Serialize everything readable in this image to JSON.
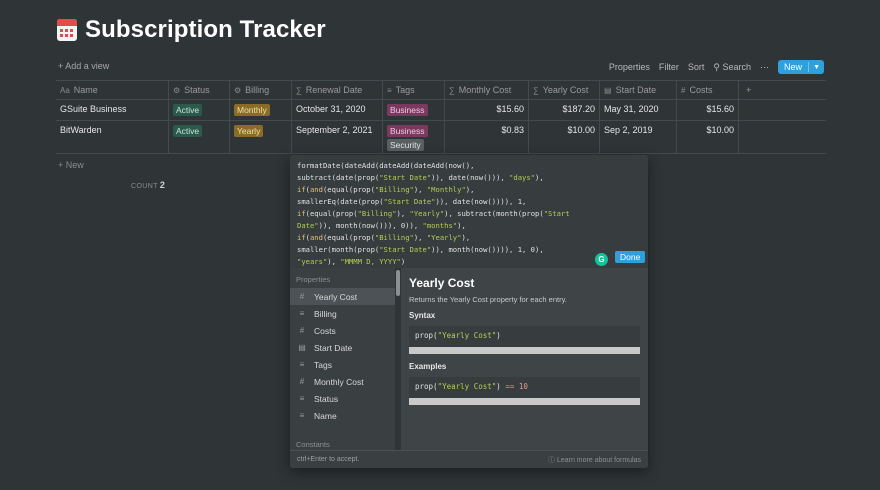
{
  "page": {
    "title": "Subscription Tracker",
    "icon": "calendar-icon"
  },
  "toolbar": {
    "add_view": "+ Add a view",
    "properties": "Properties",
    "filter": "Filter",
    "sort": "Sort",
    "search": "Search",
    "more": "⋯",
    "new": "New"
  },
  "table": {
    "headers": [
      {
        "icon": "Aa",
        "label": "Name"
      },
      {
        "icon": "⚙",
        "label": "Status"
      },
      {
        "icon": "⚙",
        "label": "Billing"
      },
      {
        "icon": "∑",
        "label": "Renewal Date"
      },
      {
        "icon": "≡",
        "label": "Tags"
      },
      {
        "icon": "∑",
        "label": "Monthly Cost"
      },
      {
        "icon": "∑",
        "label": "Yearly Cost"
      },
      {
        "icon": "▤",
        "label": "Start Date"
      },
      {
        "icon": "#",
        "label": "Costs"
      },
      {
        "icon": "+",
        "label": ""
      }
    ],
    "rows": [
      {
        "name": "GSuite Business",
        "status": "Active",
        "billing": "Monthly",
        "renewal": "October 31, 2020",
        "tags": [
          "Business"
        ],
        "monthly": "$15.60",
        "yearly": "$187.20",
        "start": "May 31, 2020",
        "costs": "$15.60"
      },
      {
        "name": "BitWarden",
        "status": "Active",
        "billing": "Yearly",
        "renewal": "September 2, 2021",
        "tags": [
          "Business",
          "Security"
        ],
        "monthly": "$0.83",
        "yearly": "$10.00",
        "start": "Sep 2, 2019",
        "costs": "$10.00"
      }
    ],
    "new_row": "+ New",
    "count_label": "COUNT",
    "count_value": "2"
  },
  "formula": {
    "done": "Done",
    "properties_heading": "Properties",
    "constants_heading": "Constants",
    "properties": [
      {
        "icon": "#",
        "label": "Yearly Cost"
      },
      {
        "icon": "≡",
        "label": "Billing"
      },
      {
        "icon": "#",
        "label": "Costs"
      },
      {
        "icon": "▤",
        "label": "Start Date"
      },
      {
        "icon": "≡",
        "label": "Tags"
      },
      {
        "icon": "#",
        "label": "Monthly Cost"
      },
      {
        "icon": "≡",
        "label": "Status"
      },
      {
        "icon": "≡",
        "label": "Name"
      }
    ],
    "doc_title": "Yearly Cost",
    "doc_desc": "Returns the Yearly Cost property for each entry.",
    "syntax_heading": "Syntax",
    "syntax_code": "prop(\"Yearly Cost\")",
    "examples_heading": "Examples",
    "example_code": "prop(\"Yearly Cost\") == 10",
    "footer_hint": "ctrl+Enter to accept.",
    "footer_learn": "Learn more about formulas"
  }
}
